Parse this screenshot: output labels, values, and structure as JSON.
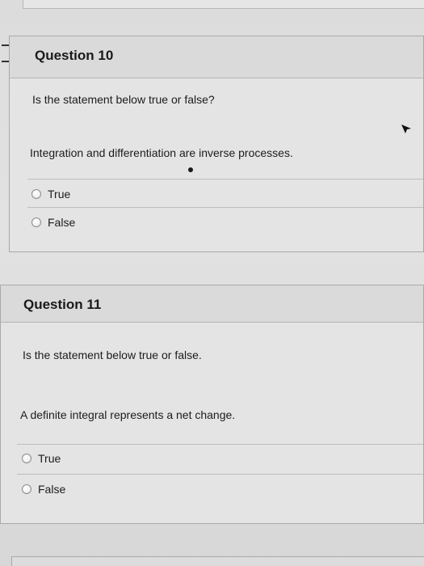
{
  "questions": [
    {
      "title": "Question 10",
      "prompt": "Is the statement below true or false?",
      "statement": "Integration and differentiation are inverse processes.",
      "options": [
        "True",
        "False"
      ]
    },
    {
      "title": "Question 11",
      "prompt": "Is the statement below true or false.",
      "statement": "A definite integral represents a net change.",
      "options": [
        "True",
        "False"
      ]
    }
  ],
  "colors": {
    "background": "#d9d9d9",
    "card": "#e4e4e4",
    "header": "#dadada",
    "border": "#a9a9a9"
  }
}
